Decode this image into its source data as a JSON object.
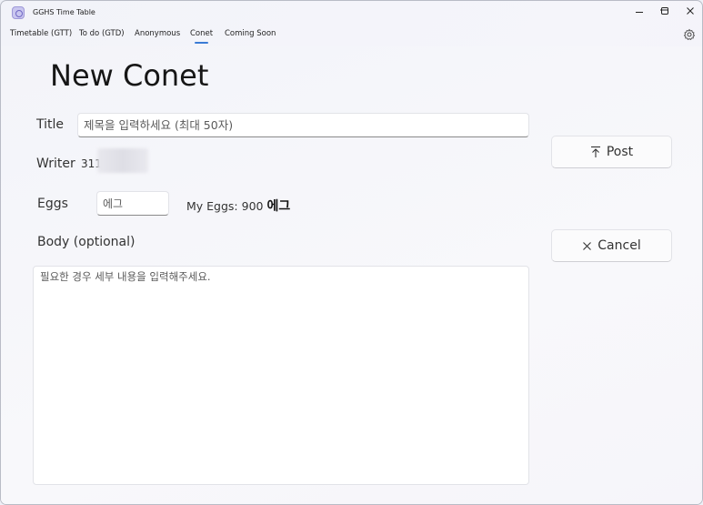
{
  "window": {
    "title": "GGHS Time Table",
    "controls": {
      "minimize": "—",
      "maximize": "☐",
      "close": "✕"
    }
  },
  "tabs": [
    {
      "label": "Timetable (GTT)",
      "active": false
    },
    {
      "label": "To do (GTD)",
      "active": false
    },
    {
      "label": "Anonymous",
      "active": false
    },
    {
      "label": "Conet",
      "active": true
    },
    {
      "label": "Coming Soon",
      "active": false
    }
  ],
  "page": {
    "title": "New Conet"
  },
  "form": {
    "title_label": "Title",
    "title_placeholder": "제목을 입력하세요 (최대 50자)",
    "title_value": "",
    "writer_label": "Writer",
    "writer_value": "311",
    "eggs_label": "Eggs",
    "eggs_placeholder": "에그",
    "eggs_value": "",
    "my_eggs_prefix": "My Eggs: 900",
    "my_eggs_unit": "에그",
    "body_label": "Body (optional)",
    "body_placeholder": "필요한 경우 세부 내용을 입력해주세요.",
    "body_value": ""
  },
  "actions": {
    "post_label": "Post",
    "post_icon": "upload-icon",
    "cancel_label": "Cancel",
    "cancel_icon": "close-icon"
  },
  "colors": {
    "accent": "#3a7bd5",
    "background": "#f3f4f9",
    "input_bg": "#ffffff"
  }
}
